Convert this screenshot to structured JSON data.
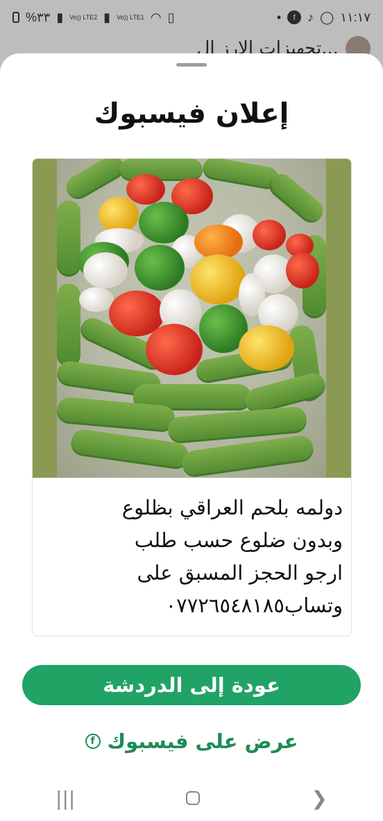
{
  "status_bar": {
    "battery": "%٣٣",
    "network_1": "Vo)) LTE2",
    "network_2": "Vo)) LTE1",
    "time": "١١:١٧",
    "icons": [
      "battery-icon",
      "signal-icon",
      "signal-icon",
      "wifi-icon",
      "sim-icon",
      "dot-icon",
      "facebook-icon",
      "tiktok-icon",
      "whatsapp-icon"
    ]
  },
  "background_chat": {
    "title": "تجهيزات الارز ال..."
  },
  "sheet": {
    "title": "إعلان فيسبوك",
    "ad": {
      "caption_lines": [
        "دولمه بلحم العراقي بظلوع",
        "وبدون ضلوع حسب طلب",
        "ارجو الحجز المسبق على",
        "وتساب٠٧٧٢٦٥٤٨١٨٥"
      ]
    },
    "primary_button": "عودة إلى الدردشة",
    "facebook_link": "عرض على فيسبوك"
  },
  "nav_bar": {
    "recents": "|||",
    "back": "❯"
  },
  "colors": {
    "accent": "#21a366",
    "link": "#1d8c57",
    "photo_bg": "#8b9a52"
  }
}
